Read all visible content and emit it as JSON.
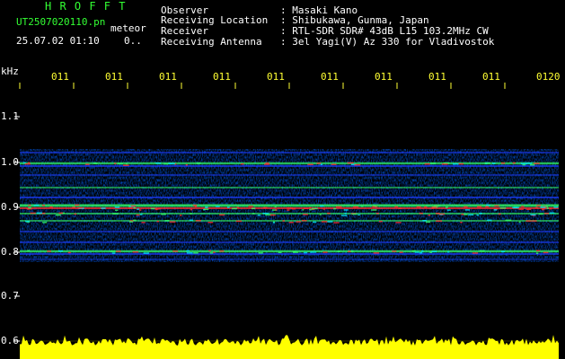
{
  "header": {
    "brand": "H R O F F T",
    "filename": "UT2507020110.pn",
    "mode": "meteor",
    "datetime": "25.07.02 01:10",
    "page": "0..",
    "fields": [
      {
        "label": "Observer",
        "value": ": Masaki Kano"
      },
      {
        "label": "Receiving Location",
        "value": ": Shibukawa, Gunma, Japan"
      },
      {
        "label": "Receiver",
        "value": ": RTL-SDR SDR# 43dB L15 103.2MHz CW"
      },
      {
        "label": "Receiving Antenna",
        "value": ": 3el Yagi(V) Az 330 for Vladivostok"
      }
    ]
  },
  "axis": {
    "unit": "kHz",
    "y_ticks": [
      "1.1",
      "1.0",
      "0.9",
      "0.8",
      "0.7",
      "0.6"
    ],
    "time_ticks": [
      "011",
      "011",
      "011",
      "011",
      "011",
      "011",
      "011",
      "011",
      "011",
      "0120"
    ]
  },
  "colors": {
    "background": "#000000",
    "text": "#ffffff",
    "brand": "#33ff33",
    "ticks": "#ffff33",
    "signal_strong": "#ff3030",
    "signal_mid": "#33ff66",
    "signal_low": "#1e3cff",
    "amplitude": "#ffff00"
  }
}
